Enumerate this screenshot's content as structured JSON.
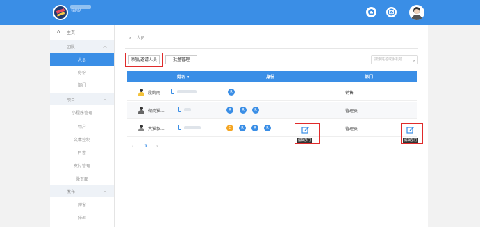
{
  "header": {
    "brand": "我的站",
    "icons": [
      "notification-icon",
      "mail-icon",
      "user-avatar"
    ]
  },
  "sidebar": {
    "home": "主页",
    "groups": [
      {
        "label": "团队",
        "items": [
          "人员",
          "身份",
          "部门"
        ]
      },
      {
        "label": "项目",
        "items": [
          "小程序管理",
          "用户",
          "文本控制",
          "日志",
          "支付管理",
          "微页面"
        ]
      },
      {
        "label": "发布",
        "items": [
          "弹窗",
          "弹框"
        ]
      }
    ],
    "active_item": "人员"
  },
  "main": {
    "breadcrumb": "人员",
    "buttons": {
      "add": "添加/邀请人员",
      "batch": "批量管理"
    },
    "search": {
      "placeholder": "搜索姓名或手机号"
    },
    "table": {
      "headers": {
        "name": "姓名 ▾",
        "identity": "身份",
        "dept": "部门"
      },
      "rows": [
        {
          "name": "段婉雨",
          "dept": "销售",
          "roles": [
            "R"
          ]
        },
        {
          "name": "微商猫...",
          "dept": "管理员",
          "roles": [
            "R",
            "R",
            "R"
          ]
        },
        {
          "name": "大猫叔...",
          "dept": "管理员",
          "roles": [
            "C",
            "R",
            "R",
            "R"
          ]
        }
      ]
    },
    "tooltips": {
      "edit_dept_1": "编辑部门",
      "edit_dept_2": "编辑部门"
    },
    "pager": {
      "prev": "‹",
      "page": "1",
      "next": "›"
    }
  },
  "colors": {
    "primary": "#3a8ee6",
    "highlight": "#e02b2b",
    "crown": "#f5a623"
  }
}
